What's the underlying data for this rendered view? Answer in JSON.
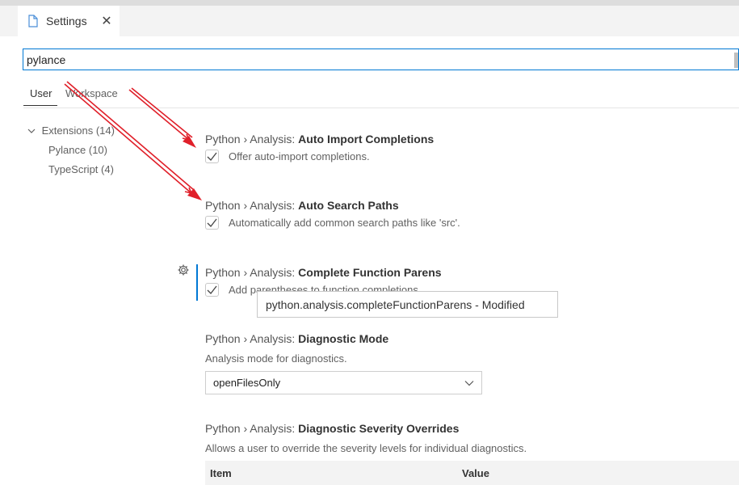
{
  "tab": {
    "title": "Settings",
    "close_glyph": "✕"
  },
  "search": {
    "value": "pylance"
  },
  "scope_tabs": {
    "user": "User",
    "workspace": "Workspace"
  },
  "tree": {
    "root": "Extensions (14)",
    "children": [
      "Pylance (10)",
      "TypeScript (4)"
    ]
  },
  "settings": [
    {
      "category": "Python › Analysis: ",
      "name": "Auto Import Completions",
      "checkbox_label": "Offer auto-import completions.",
      "checked": true
    },
    {
      "category": "Python › Analysis: ",
      "name": "Auto Search Paths",
      "checkbox_label": "Automatically add common search paths like 'src'.",
      "checked": true
    },
    {
      "category": "Python › Analysis: ",
      "name": "Complete Function Parens",
      "checkbox_label": "Add parentheses to function completions.",
      "checked": true
    },
    {
      "category": "Python › Analysis: ",
      "name": "Diagnostic Mode",
      "description": "Analysis mode for diagnostics.",
      "select_value": "openFilesOnly"
    },
    {
      "category": "Python › Analysis: ",
      "name": "Diagnostic Severity Overrides",
      "description": "Allows a user to override the severity levels for individual diagnostics.",
      "table_headers": [
        "Item",
        "Value"
      ]
    }
  ],
  "tooltip": "python.analysis.completeFunctionParens - Modified",
  "icons": {
    "tab": "file-icon",
    "gear": "gear-icon",
    "tree": "chevron-down-icon",
    "select": "chevron-down-icon"
  },
  "colors": {
    "accent": "#0078d4",
    "annotation_arrow": "#e0202a"
  }
}
